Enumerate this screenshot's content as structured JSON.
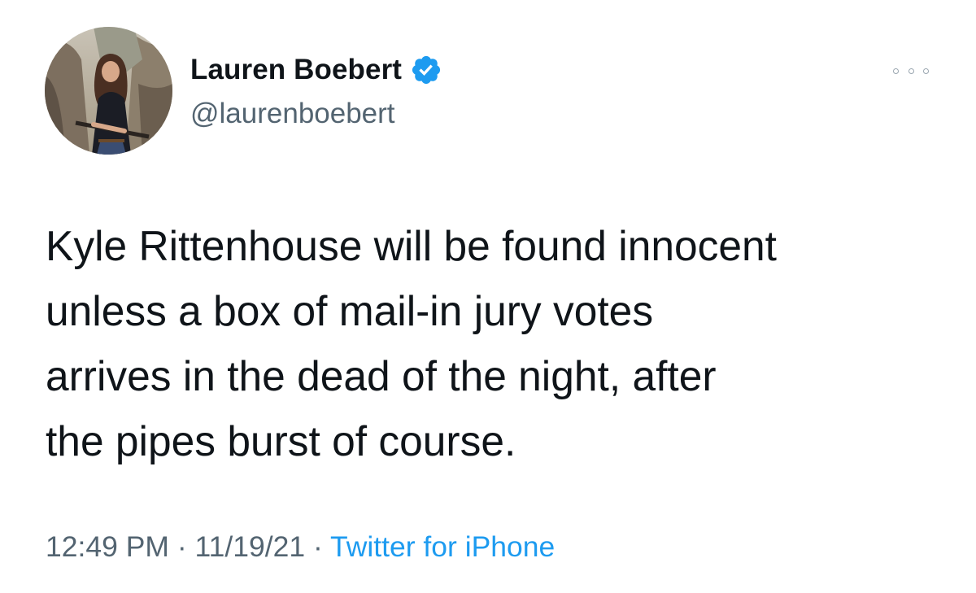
{
  "author": {
    "display_name": "Lauren Boebert",
    "handle": "@laurenboebert",
    "verified": true,
    "verified_color": "#1d9bf0"
  },
  "tweet": {
    "text_lines": [
      "Kyle Rittenhouse will be found innocent",
      "unless a box of mail-in jury votes",
      "arrives in the dead of the night, after",
      "the pipes burst of course."
    ]
  },
  "meta": {
    "time": "12:49 PM",
    "separator": " · ",
    "date": "11/19/21",
    "source": "Twitter for iPhone"
  },
  "icons": {
    "more": "more-options-icon",
    "verified": "verified-badge-icon"
  },
  "colors": {
    "text_primary": "#0f1419",
    "text_secondary": "#536471",
    "link": "#1d9bf0"
  }
}
